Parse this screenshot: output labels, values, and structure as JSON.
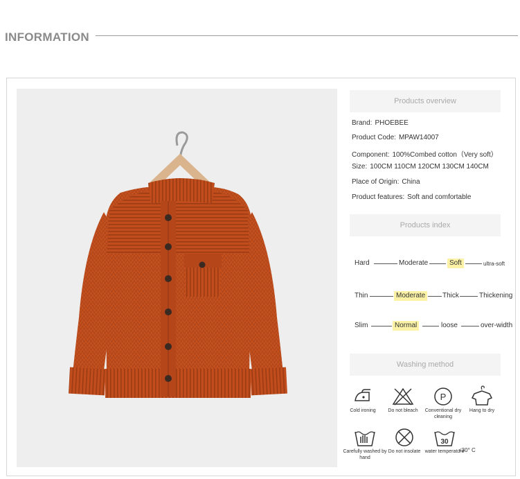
{
  "header": {
    "title": "INFORMATION"
  },
  "overview": {
    "heading": "Products overview",
    "rows": [
      {
        "label": "Brand:",
        "value": "PHOEBEE"
      },
      {
        "label": "Product Code:",
        "value": "MPAW14007"
      },
      {
        "label": "Component:",
        "value": "100%Combed cotton（Very soft）"
      },
      {
        "label": "Size:",
        "value": "100CM  110CM  120CM  130CM  140CM"
      },
      {
        "label": "Place of Origin:",
        "value": "China"
      },
      {
        "label": "Product features:",
        "value": "Soft and comfortable"
      }
    ]
  },
  "index": {
    "heading": "Products index",
    "scales": [
      {
        "items": [
          "Hard",
          "Moderate",
          "Soft",
          "ultra-soft"
        ],
        "selected": "Soft"
      },
      {
        "items": [
          "Thin",
          "Moderate",
          "Thick",
          "Thickening"
        ],
        "selected": "Moderate"
      },
      {
        "items": [
          "Slim",
          "Normal",
          "loose",
          "over-width"
        ],
        "selected": "Normal"
      }
    ]
  },
  "washing": {
    "heading": "Washing method",
    "items": [
      {
        "icon": "iron-icon",
        "label": "Cold ironing"
      },
      {
        "icon": "no-bleach-icon",
        "label": "Do not bleach"
      },
      {
        "icon": "dry-clean-icon",
        "label": "Conventional dry cleaning",
        "symbol": "P"
      },
      {
        "icon": "hang-dry-icon",
        "label": "Hang to dry"
      },
      {
        "icon": "hand-wash-icon",
        "label": "Carefully washed by hand"
      },
      {
        "icon": "no-tumble-dry-icon",
        "label": "Do not insolate"
      },
      {
        "icon": "water-temp-icon",
        "label": "water temperature",
        "symbol": "30"
      }
    ],
    "temperature_note": "<30° C"
  },
  "colors": {
    "sweater": "#c4501e",
    "highlight": "#fbf2a6",
    "section_bg": "#f4f4f4"
  }
}
